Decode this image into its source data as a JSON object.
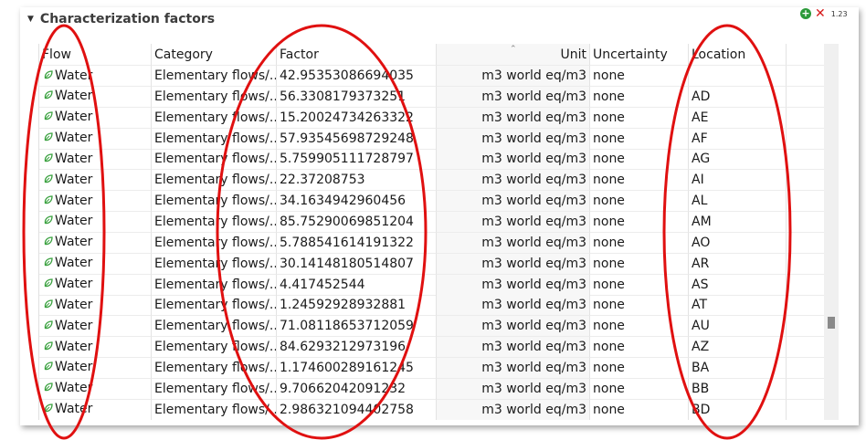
{
  "section": {
    "title": "Characterization factors"
  },
  "toolbar": {
    "add_label": "+",
    "remove_label": "✕",
    "format_label": "1.23"
  },
  "table": {
    "columns": [
      "Flow",
      "Category",
      "Factor",
      "Unit",
      "Uncertainty",
      "Location"
    ],
    "rows": [
      {
        "flow": "Water",
        "category": "Elementary flows/...",
        "factor": "42.95353086694035",
        "unit": "m3 world eq/m3",
        "uncertainty": "none",
        "location": ""
      },
      {
        "flow": "Water",
        "category": "Elementary flows/...",
        "factor": "56.3308179373251",
        "unit": "m3 world eq/m3",
        "uncertainty": "none",
        "location": "AD"
      },
      {
        "flow": "Water",
        "category": "Elementary flows/...",
        "factor": "15.20024734263322",
        "unit": "m3 world eq/m3",
        "uncertainty": "none",
        "location": "AE"
      },
      {
        "flow": "Water",
        "category": "Elementary flows/...",
        "factor": "57.93545698729248",
        "unit": "m3 world eq/m3",
        "uncertainty": "none",
        "location": "AF"
      },
      {
        "flow": "Water",
        "category": "Elementary flows/...",
        "factor": "5.759905111728797",
        "unit": "m3 world eq/m3",
        "uncertainty": "none",
        "location": "AG"
      },
      {
        "flow": "Water",
        "category": "Elementary flows/...",
        "factor": "22.37208753",
        "unit": "m3 world eq/m3",
        "uncertainty": "none",
        "location": "AI"
      },
      {
        "flow": "Water",
        "category": "Elementary flows/...",
        "factor": "34.1634942960456",
        "unit": "m3 world eq/m3",
        "uncertainty": "none",
        "location": "AL"
      },
      {
        "flow": "Water",
        "category": "Elementary flows/...",
        "factor": "85.75290069851204",
        "unit": "m3 world eq/m3",
        "uncertainty": "none",
        "location": "AM"
      },
      {
        "flow": "Water",
        "category": "Elementary flows/...",
        "factor": "5.788541614191322",
        "unit": "m3 world eq/m3",
        "uncertainty": "none",
        "location": "AO"
      },
      {
        "flow": "Water",
        "category": "Elementary flows/...",
        "factor": "30.14148180514807",
        "unit": "m3 world eq/m3",
        "uncertainty": "none",
        "location": "AR"
      },
      {
        "flow": "Water",
        "category": "Elementary flows/...",
        "factor": "4.417452544",
        "unit": "m3 world eq/m3",
        "uncertainty": "none",
        "location": "AS"
      },
      {
        "flow": "Water",
        "category": "Elementary flows/...",
        "factor": "1.24592928932881",
        "unit": "m3 world eq/m3",
        "uncertainty": "none",
        "location": "AT"
      },
      {
        "flow": "Water",
        "category": "Elementary flows/...",
        "factor": "71.08118653712059",
        "unit": "m3 world eq/m3",
        "uncertainty": "none",
        "location": "AU"
      },
      {
        "flow": "Water",
        "category": "Elementary flows/...",
        "factor": "84.6293212973196",
        "unit": "m3 world eq/m3",
        "uncertainty": "none",
        "location": "AZ"
      },
      {
        "flow": "Water",
        "category": "Elementary flows/...",
        "factor": "1.174600289161245",
        "unit": "m3 world eq/m3",
        "uncertainty": "none",
        "location": "BA"
      },
      {
        "flow": "Water",
        "category": "Elementary flows/...",
        "factor": "9.70662042091232",
        "unit": "m3 world eq/m3",
        "uncertainty": "none",
        "location": "BB"
      },
      {
        "flow": "Water",
        "category": "Elementary flows/...",
        "factor": "2.986321094402758",
        "unit": "m3 world eq/m3",
        "uncertainty": "none",
        "location": "BD"
      }
    ]
  },
  "colors": {
    "leaf_icon": "#3aa13f",
    "annotation": "#e01010",
    "add_icon": "#2c9a3a",
    "remove_icon": "#d61a1a"
  },
  "annotations": {
    "type": "red-ellipse",
    "around_columns": [
      "Flow",
      "Factor",
      "Location"
    ]
  }
}
